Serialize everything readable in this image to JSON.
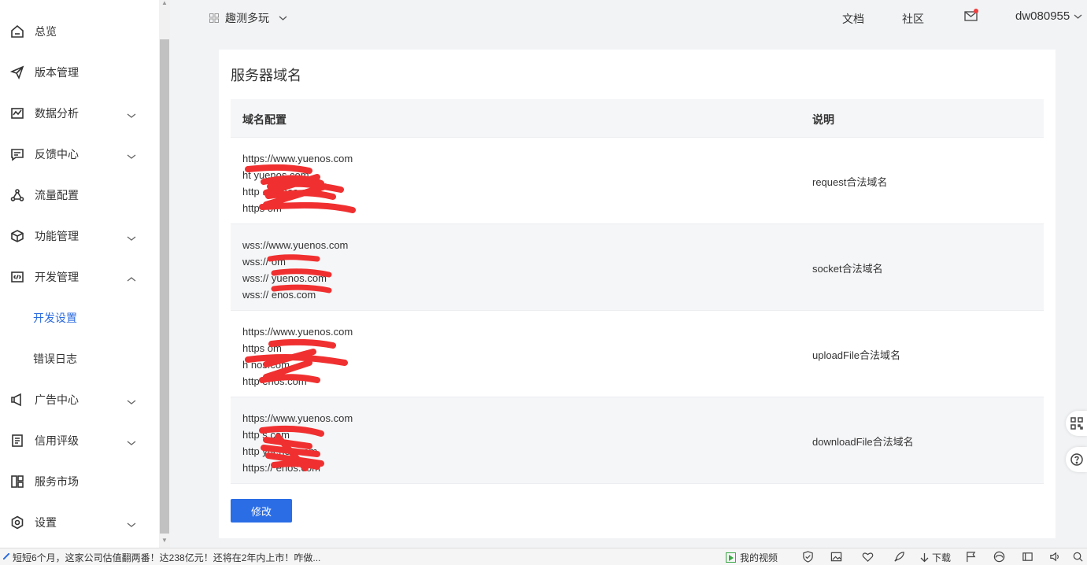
{
  "topbar": {
    "app_name": "趣测多玩",
    "links": [
      "文档",
      "社区"
    ],
    "username": "dw080955"
  },
  "sidebar": {
    "items": [
      {
        "label": "总览",
        "icon": "home-icon"
      },
      {
        "label": "版本管理",
        "icon": "send-icon"
      },
      {
        "label": "数据分析",
        "icon": "chart-icon"
      },
      {
        "label": "反馈中心",
        "icon": "message-icon"
      },
      {
        "label": "流量配置",
        "icon": "share-icon"
      },
      {
        "label": "功能管理",
        "icon": "cube-icon"
      },
      {
        "label": "开发管理",
        "icon": "code-icon"
      },
      {
        "label": "广告中心",
        "icon": "megaphone-icon"
      },
      {
        "label": "信用评级",
        "icon": "document-icon"
      },
      {
        "label": "服务市场",
        "icon": "layout-icon"
      },
      {
        "label": "设置",
        "icon": "settings-icon"
      }
    ],
    "sub_items": [
      {
        "label": "开发设置",
        "active": true
      },
      {
        "label": "错误日志",
        "active": false
      }
    ]
  },
  "card": {
    "title": "服务器域名",
    "columns": [
      "域名配置",
      "说明"
    ],
    "rows": [
      {
        "domains": [
          "https://www.yuenos.com",
          "ht              yuenos.com",
          "http                   .yuenos.com",
          "https                         om"
        ],
        "desc": "request合法域名"
      },
      {
        "domains": [
          "wss://www.yuenos.com",
          "wss://                   om",
          "wss://              yuenos.com",
          "wss://               enos.com"
        ],
        "desc": "socket合法域名"
      },
      {
        "domains": [
          "https://www.yuenos.com",
          "https               om",
          "h                          nos.com",
          "http                   enos.com"
        ],
        "desc": "uploadFile合法域名"
      },
      {
        "domains": [
          "https://www.yuenos.com",
          "http               s.com",
          "http               yuenos.com",
          "https://              enos.com"
        ],
        "desc": "downloadFile合法域名"
      }
    ],
    "edit_label": "修改"
  },
  "statusbar": {
    "news": "短短6个月，这家公司估值翻两番！达238亿元！还将在2年内上市！咋做...",
    "video_label": "我的视频",
    "download_label": "下载"
  },
  "colors": {
    "accent": "#2c6be0",
    "button": "#2b6de5",
    "redaction": "#f03030"
  }
}
